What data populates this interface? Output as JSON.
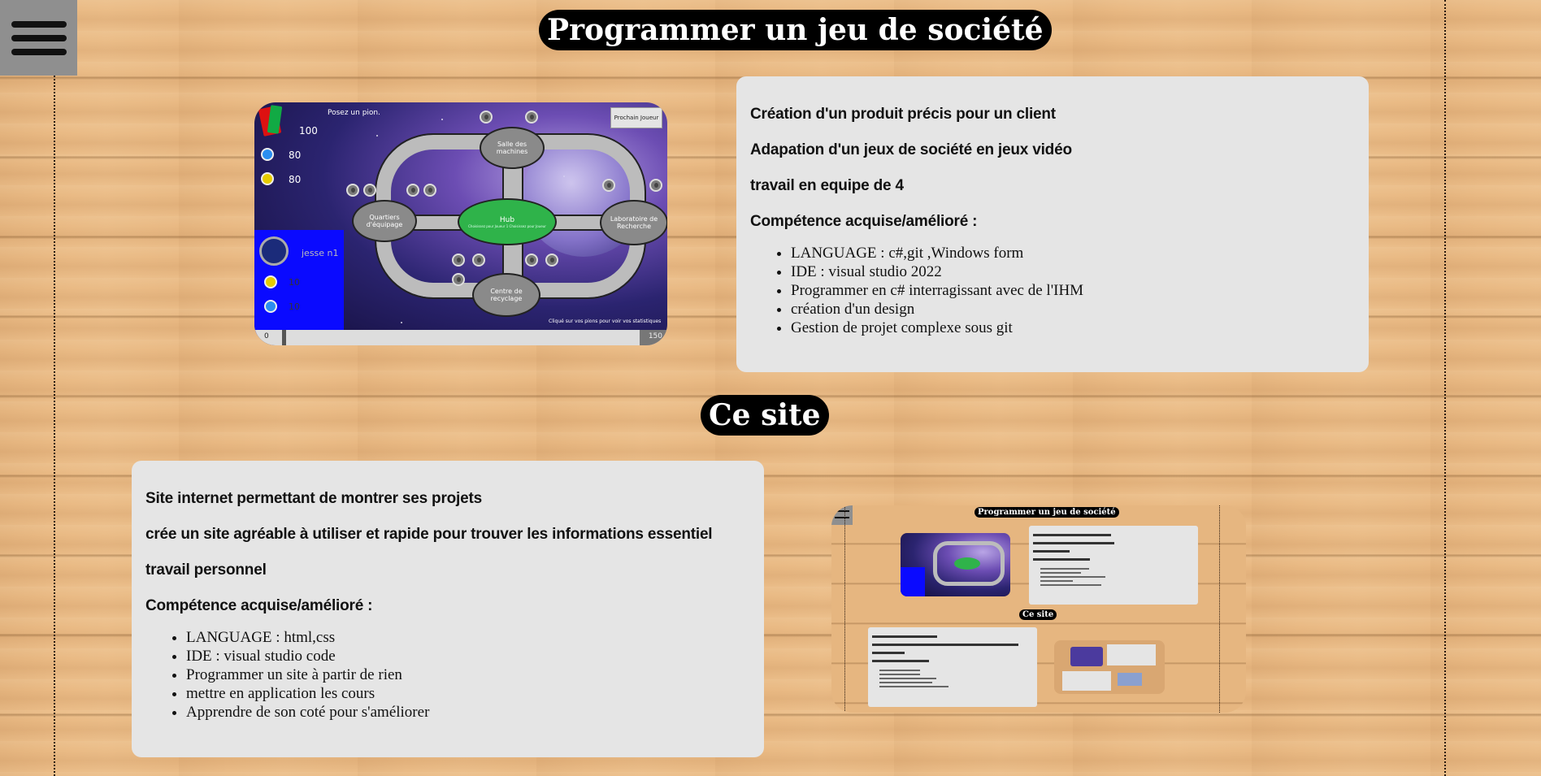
{
  "menu": {
    "icon": "hamburger-menu-icon"
  },
  "project1": {
    "title": "Programmer un jeu de société",
    "lines": [
      "Création d'un produit précis pour un client",
      "Adapation d'un jeux de société en jeux vidéo",
      "travail en equipe de 4",
      "Compétence acquise/amélioré :"
    ],
    "skills": [
      "LANGUAGE : c#,git ,Windows form",
      "IDE : visual studio 2022",
      "Programmer en c# interragissant avec de l'IHM",
      "création d'un design",
      "Gestion de projet complexe sous git"
    ],
    "screenshot": {
      "status": "Posez un pion.",
      "next_button": "Prochain Joueur",
      "cards_count": "100",
      "water": "80",
      "energy": "80",
      "player_name": "jesse n1",
      "player_energy": "10",
      "player_water": "10",
      "rooms": [
        "Salle des machines",
        "Quartiers d'équipage",
        "Hub",
        "Laboratoire de Recherche",
        "Centre de recyclage"
      ],
      "hub_sub": "Choisissez pour Joueur 1 Choisissez pour Joueur",
      "hint": "Cliqué sur vos pions pour voir vos statistiques",
      "progress_left": "0",
      "progress_right": "150"
    }
  },
  "project2": {
    "title": "Ce site",
    "lines": [
      "Site internet permettant de montrer ses projets",
      "crée un site agréable à utiliser et rapide pour trouver les informations essentiel",
      "travail personnel",
      "Compétence acquise/amélioré :"
    ],
    "skills": [
      "LANGUAGE : html,css",
      "IDE : visual studio code",
      "Programmer un site à partir de rien",
      "mettre en application les cours",
      "Apprendre de son coté pour s'améliorer"
    ]
  }
}
